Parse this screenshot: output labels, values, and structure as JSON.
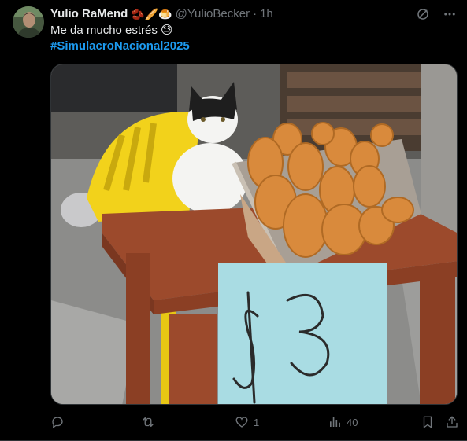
{
  "tweet": {
    "author": {
      "display_name": "Yulio RaMend",
      "name_emojis": "🫘🥖🍮",
      "handle": "@YulioBecker",
      "separator": "·",
      "time": "1h"
    },
    "text_line_1": "Me da mucho estrés 😓",
    "hashtag": "#SimulacroNacional2025",
    "media": {
      "alt": "Photo of a black and white cat sitting on a yellow chair behind a wooden table with a basket of bread rolls and a light blue sign reading $3",
      "sign_text": "$3"
    },
    "actions": {
      "reply_count": "",
      "retweet_count": "",
      "like_count": "1",
      "views_count": "40"
    }
  },
  "icons": {
    "grok": "grok-icon",
    "more": "more-icon",
    "reply": "reply-icon",
    "retweet": "retweet-icon",
    "like": "heart-icon",
    "views": "views-icon",
    "bookmark": "bookmark-icon",
    "share": "share-icon"
  },
  "colors": {
    "background": "#000000",
    "text": "#e7e9ea",
    "secondary": "#71767b",
    "hashtag": "#1d9bf0",
    "border": "#2f3336"
  }
}
